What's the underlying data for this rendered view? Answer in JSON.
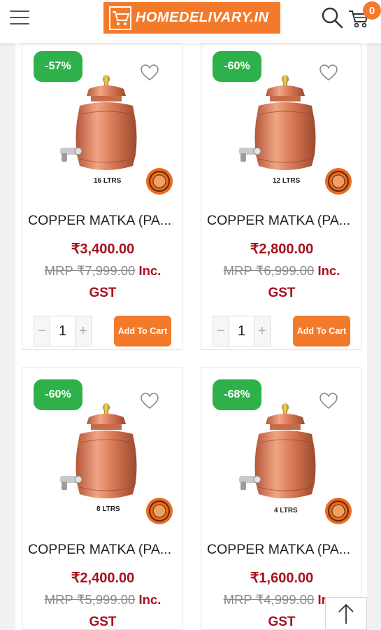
{
  "header": {
    "logo_text": "HOMEDELIVARY.IN",
    "cart_count": "0"
  },
  "colors": {
    "brand_orange": "#f47a2b",
    "discount_green": "#2eb14a",
    "price_red": "#a8101f"
  },
  "icons": {
    "menu": "hamburger-icon",
    "search": "search-icon",
    "cart": "cart-icon",
    "wishlist": "heart-icon",
    "scroll_top": "arrow-up-icon"
  },
  "products": [
    {
      "discount": "-57%",
      "capacity": "16 LTRS",
      "title": "COPPER MATKA (PA...",
      "price": "₹3,400.00",
      "mrp": "MRP ₹7,999.00",
      "inc": "Inc.",
      "gst": "GST",
      "quantity": "1",
      "button": "Add To Cart"
    },
    {
      "discount": "-60%",
      "capacity": "12 LTRS",
      "title": "COPPER MATKA (PA...",
      "price": "₹2,800.00",
      "mrp": "MRP ₹6,999.00",
      "inc": "Inc.",
      "gst": "GST",
      "quantity": "1",
      "button": "Add To Cart"
    },
    {
      "discount": "-60%",
      "capacity": "8 LTRS",
      "title": "COPPER MATKA (PA...",
      "price": "₹2,400.00",
      "mrp": "MRP ₹5,999.00",
      "inc": "Inc.",
      "gst": "GST"
    },
    {
      "discount": "-68%",
      "capacity": "4 LTRS",
      "title": "COPPER MATKA (PA...",
      "price": "₹1,600.00",
      "mrp": "MRP ₹4,999.00",
      "inc": "Inc.",
      "gst": "GST"
    }
  ]
}
